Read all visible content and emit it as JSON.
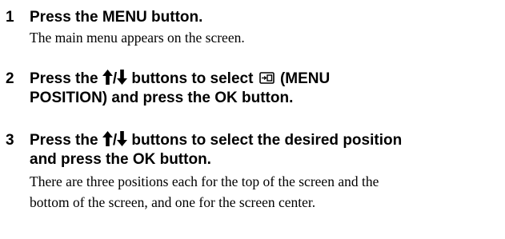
{
  "steps": [
    {
      "number": "1",
      "heading_lines": [
        "Press the MENU button."
      ],
      "description_lines": [
        "The main menu appears on the screen."
      ]
    },
    {
      "number": "2",
      "heading": {
        "prefix": "Press the",
        "slash": "/",
        "middle": "buttons to select",
        "suffix": "(MENU",
        "line2": "POSITION) and press the OK button."
      },
      "icons": [
        "up-arrow-icon",
        "down-arrow-icon",
        "menu-position-icon"
      ]
    },
    {
      "number": "3",
      "heading": {
        "prefix": "Press the",
        "slash": "/",
        "suffix": "buttons to select the desired position",
        "line2": "and press the OK button."
      },
      "icons": [
        "up-arrow-icon",
        "down-arrow-icon"
      ],
      "description_lines": [
        "There are three positions each for the top of the screen and the",
        "bottom of the screen, and one for the screen center."
      ]
    }
  ]
}
